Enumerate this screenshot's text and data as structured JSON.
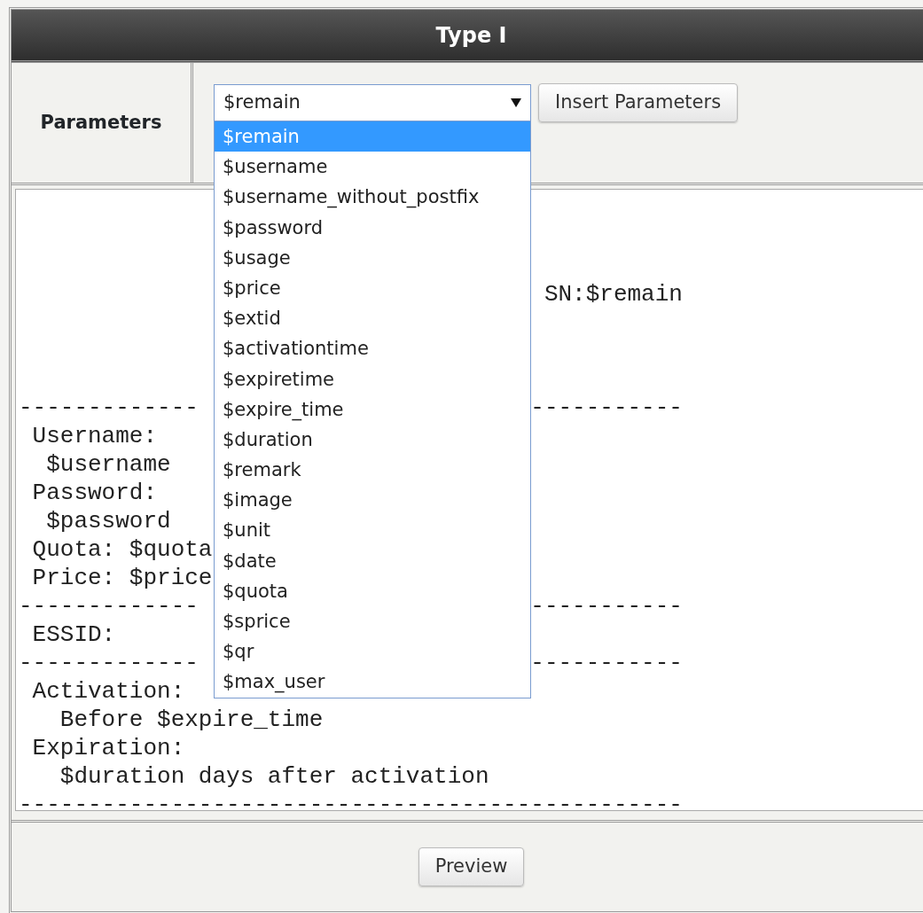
{
  "header": {
    "title": "Type I"
  },
  "parameters": {
    "label": "Parameters",
    "select": {
      "value": "$remain",
      "expanded": true,
      "options": [
        {
          "label": "$remain",
          "selected": true
        },
        {
          "label": "$username",
          "selected": false
        },
        {
          "label": "$username_without_postfix",
          "selected": false
        },
        {
          "label": "$password",
          "selected": false
        },
        {
          "label": "$usage",
          "selected": false
        },
        {
          "label": "$price",
          "selected": false
        },
        {
          "label": "$extid",
          "selected": false
        },
        {
          "label": "$activationtime",
          "selected": false
        },
        {
          "label": "$expiretime",
          "selected": false
        },
        {
          "label": "$expire_time",
          "selected": false
        },
        {
          "label": "$duration",
          "selected": false
        },
        {
          "label": "$remark",
          "selected": false
        },
        {
          "label": "$image",
          "selected": false
        },
        {
          "label": "$unit",
          "selected": false
        },
        {
          "label": "$date",
          "selected": false
        },
        {
          "label": "$quota",
          "selected": false
        },
        {
          "label": "$sprice",
          "selected": false
        },
        {
          "label": "$qr",
          "selected": false
        },
        {
          "label": "$max_user",
          "selected": false
        }
      ]
    },
    "insert_button": "Insert Parameters"
  },
  "template": {
    "content": "\n\n\n                                      SN:$remain\n\n\n\n-------------                        -----------\n Username:\n  $username\n Password:\n  $password\n Quota: $quota\n Price: $price\n-------------                        -----------\n ESSID:\n-------------                        -----------\n Activation:\n   Before $expire_time\n Expiration:\n   $duration days after activation\n------------------------------------------------"
  },
  "preview_button": "Preview"
}
